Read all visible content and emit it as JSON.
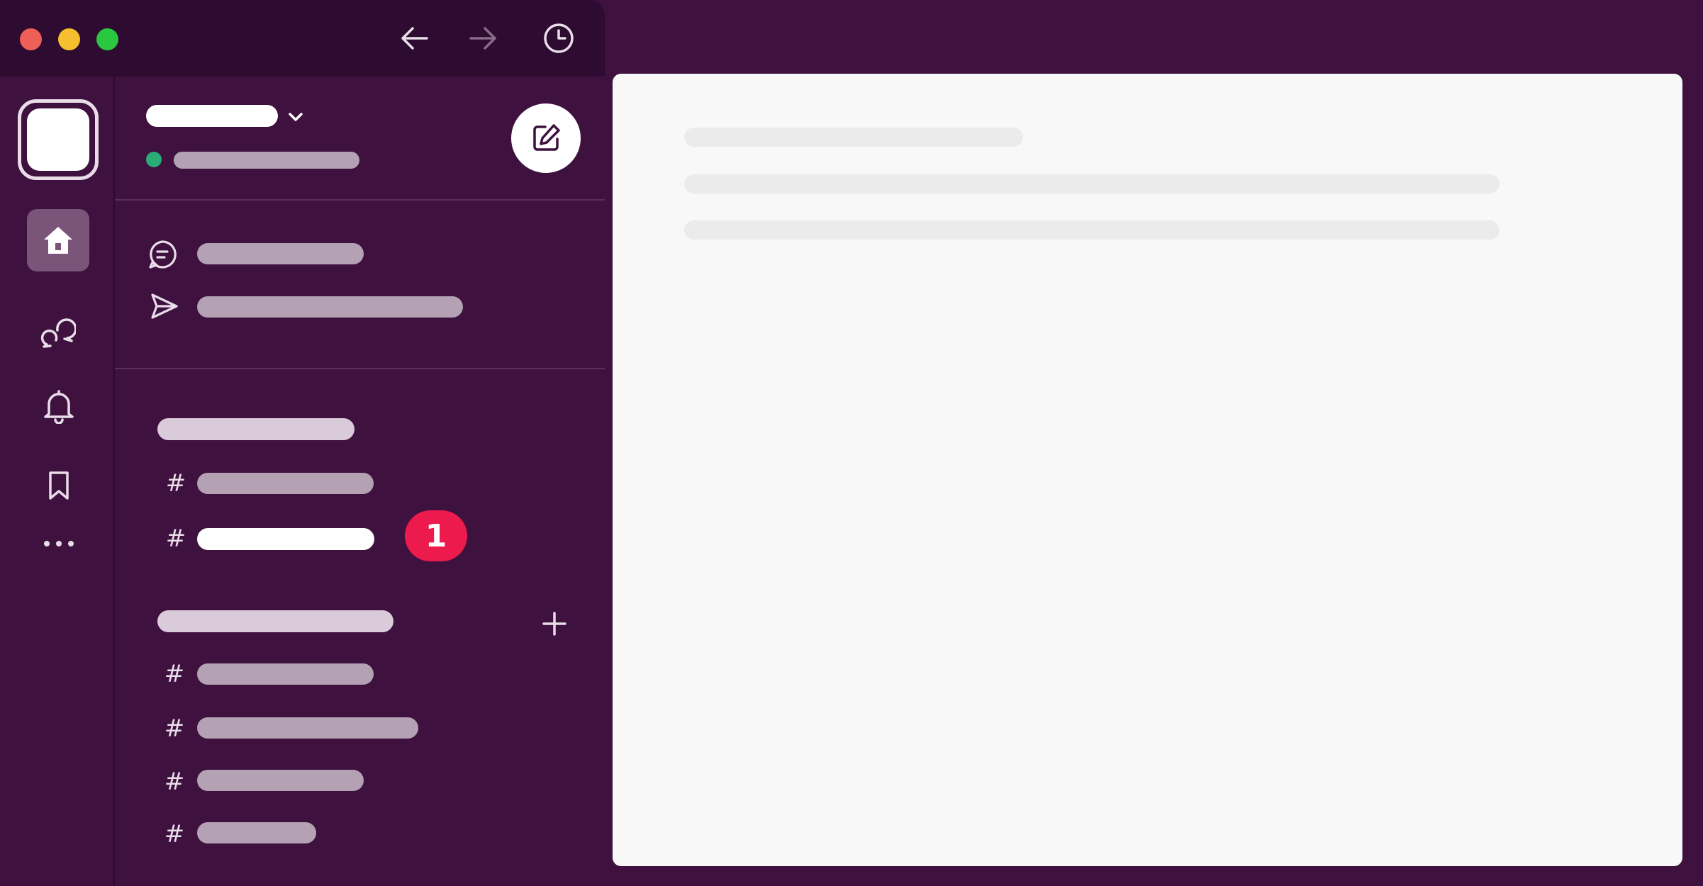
{
  "window": {
    "traffic_lights": [
      "#ed5f57",
      "#f5bf2f",
      "#2ac840"
    ]
  },
  "toolbar": {
    "back_icon": "arrow-left-icon",
    "forward_icon": "arrow-right-icon",
    "history_icon": "clock-icon"
  },
  "rail": {
    "items": [
      {
        "icon": "home-icon"
      },
      {
        "icon": "dms-icon"
      },
      {
        "icon": "bell-icon"
      },
      {
        "icon": "bookmark-icon"
      },
      {
        "icon": "more-icon"
      }
    ]
  },
  "sidebar": {
    "status_color": "#2bac76",
    "compose_icon": "compose-icon",
    "channel_prefix": "#",
    "add_icon": "plus-icon",
    "unread_count": "1"
  },
  "colors": {
    "window_bg": "#3e113e",
    "titlebar_bg": "#2e0b30",
    "badge": "#ec1a4d",
    "main_bg": "#f8f8f8"
  }
}
